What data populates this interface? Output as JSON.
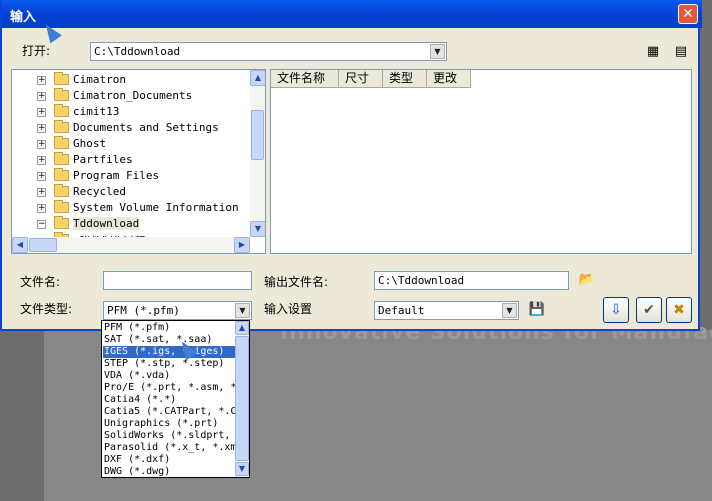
{
  "window": {
    "title": "输入",
    "close_icon": "close-icon"
  },
  "open_row": {
    "label": "打开:",
    "path": "C:\\Tddownload"
  },
  "tree": {
    "items": [
      {
        "name": "Cimatron",
        "expander": "+"
      },
      {
        "name": "Cimatron_Documents",
        "expander": "+"
      },
      {
        "name": "cimit13",
        "expander": "+"
      },
      {
        "name": "Documents and Settings",
        "expander": "+"
      },
      {
        "name": "Ghost",
        "expander": "+"
      },
      {
        "name": "Partfiles",
        "expander": "+"
      },
      {
        "name": "Program Files",
        "expander": "+"
      },
      {
        "name": "Recycled",
        "expander": "+"
      },
      {
        "name": "System Volume Information",
        "expander": "+"
      },
      {
        "name": "Tddownload",
        "expander": "−"
      },
      {
        "name": "…附件制作过程",
        "expander": ""
      }
    ]
  },
  "file_list": {
    "columns": [
      "文件名称",
      "尺寸",
      "类型",
      "更改"
    ]
  },
  "file_name": {
    "label": "文件名:",
    "value": ""
  },
  "output_name": {
    "label": "输出文件名:",
    "value": "C:\\Tddownload"
  },
  "file_type": {
    "label": "文件类型:",
    "value": "PFM (*.pfm)"
  },
  "input_setting": {
    "label": "输入设置",
    "value": "Default"
  },
  "type_options": [
    "PFM (*.pfm)",
    "SAT (*.sat, *.saa)",
    "IGES (*.igs, *.iges)",
    "STEP (*.stp, *.step)",
    "VDA (*.vda)",
    "Pro/E (*.prt, *.asm, *",
    "Catia4 (*.*)",
    "Catia5 (*.CATPart, *.C",
    "Unigraphics (*.prt)",
    "SolidWorks (*.sldprt,",
    "Parasolid (*.x_t, *.xm",
    "DXF (*.dxf)",
    "DWG (*.dwg)"
  ],
  "selected_type_index": 2,
  "background": {
    "tagline": "Innovative Solutions for Manufact"
  },
  "colors": {
    "title_bar": "#0343d6",
    "selection": "#316ac5",
    "dialog": "#ece9d8"
  }
}
